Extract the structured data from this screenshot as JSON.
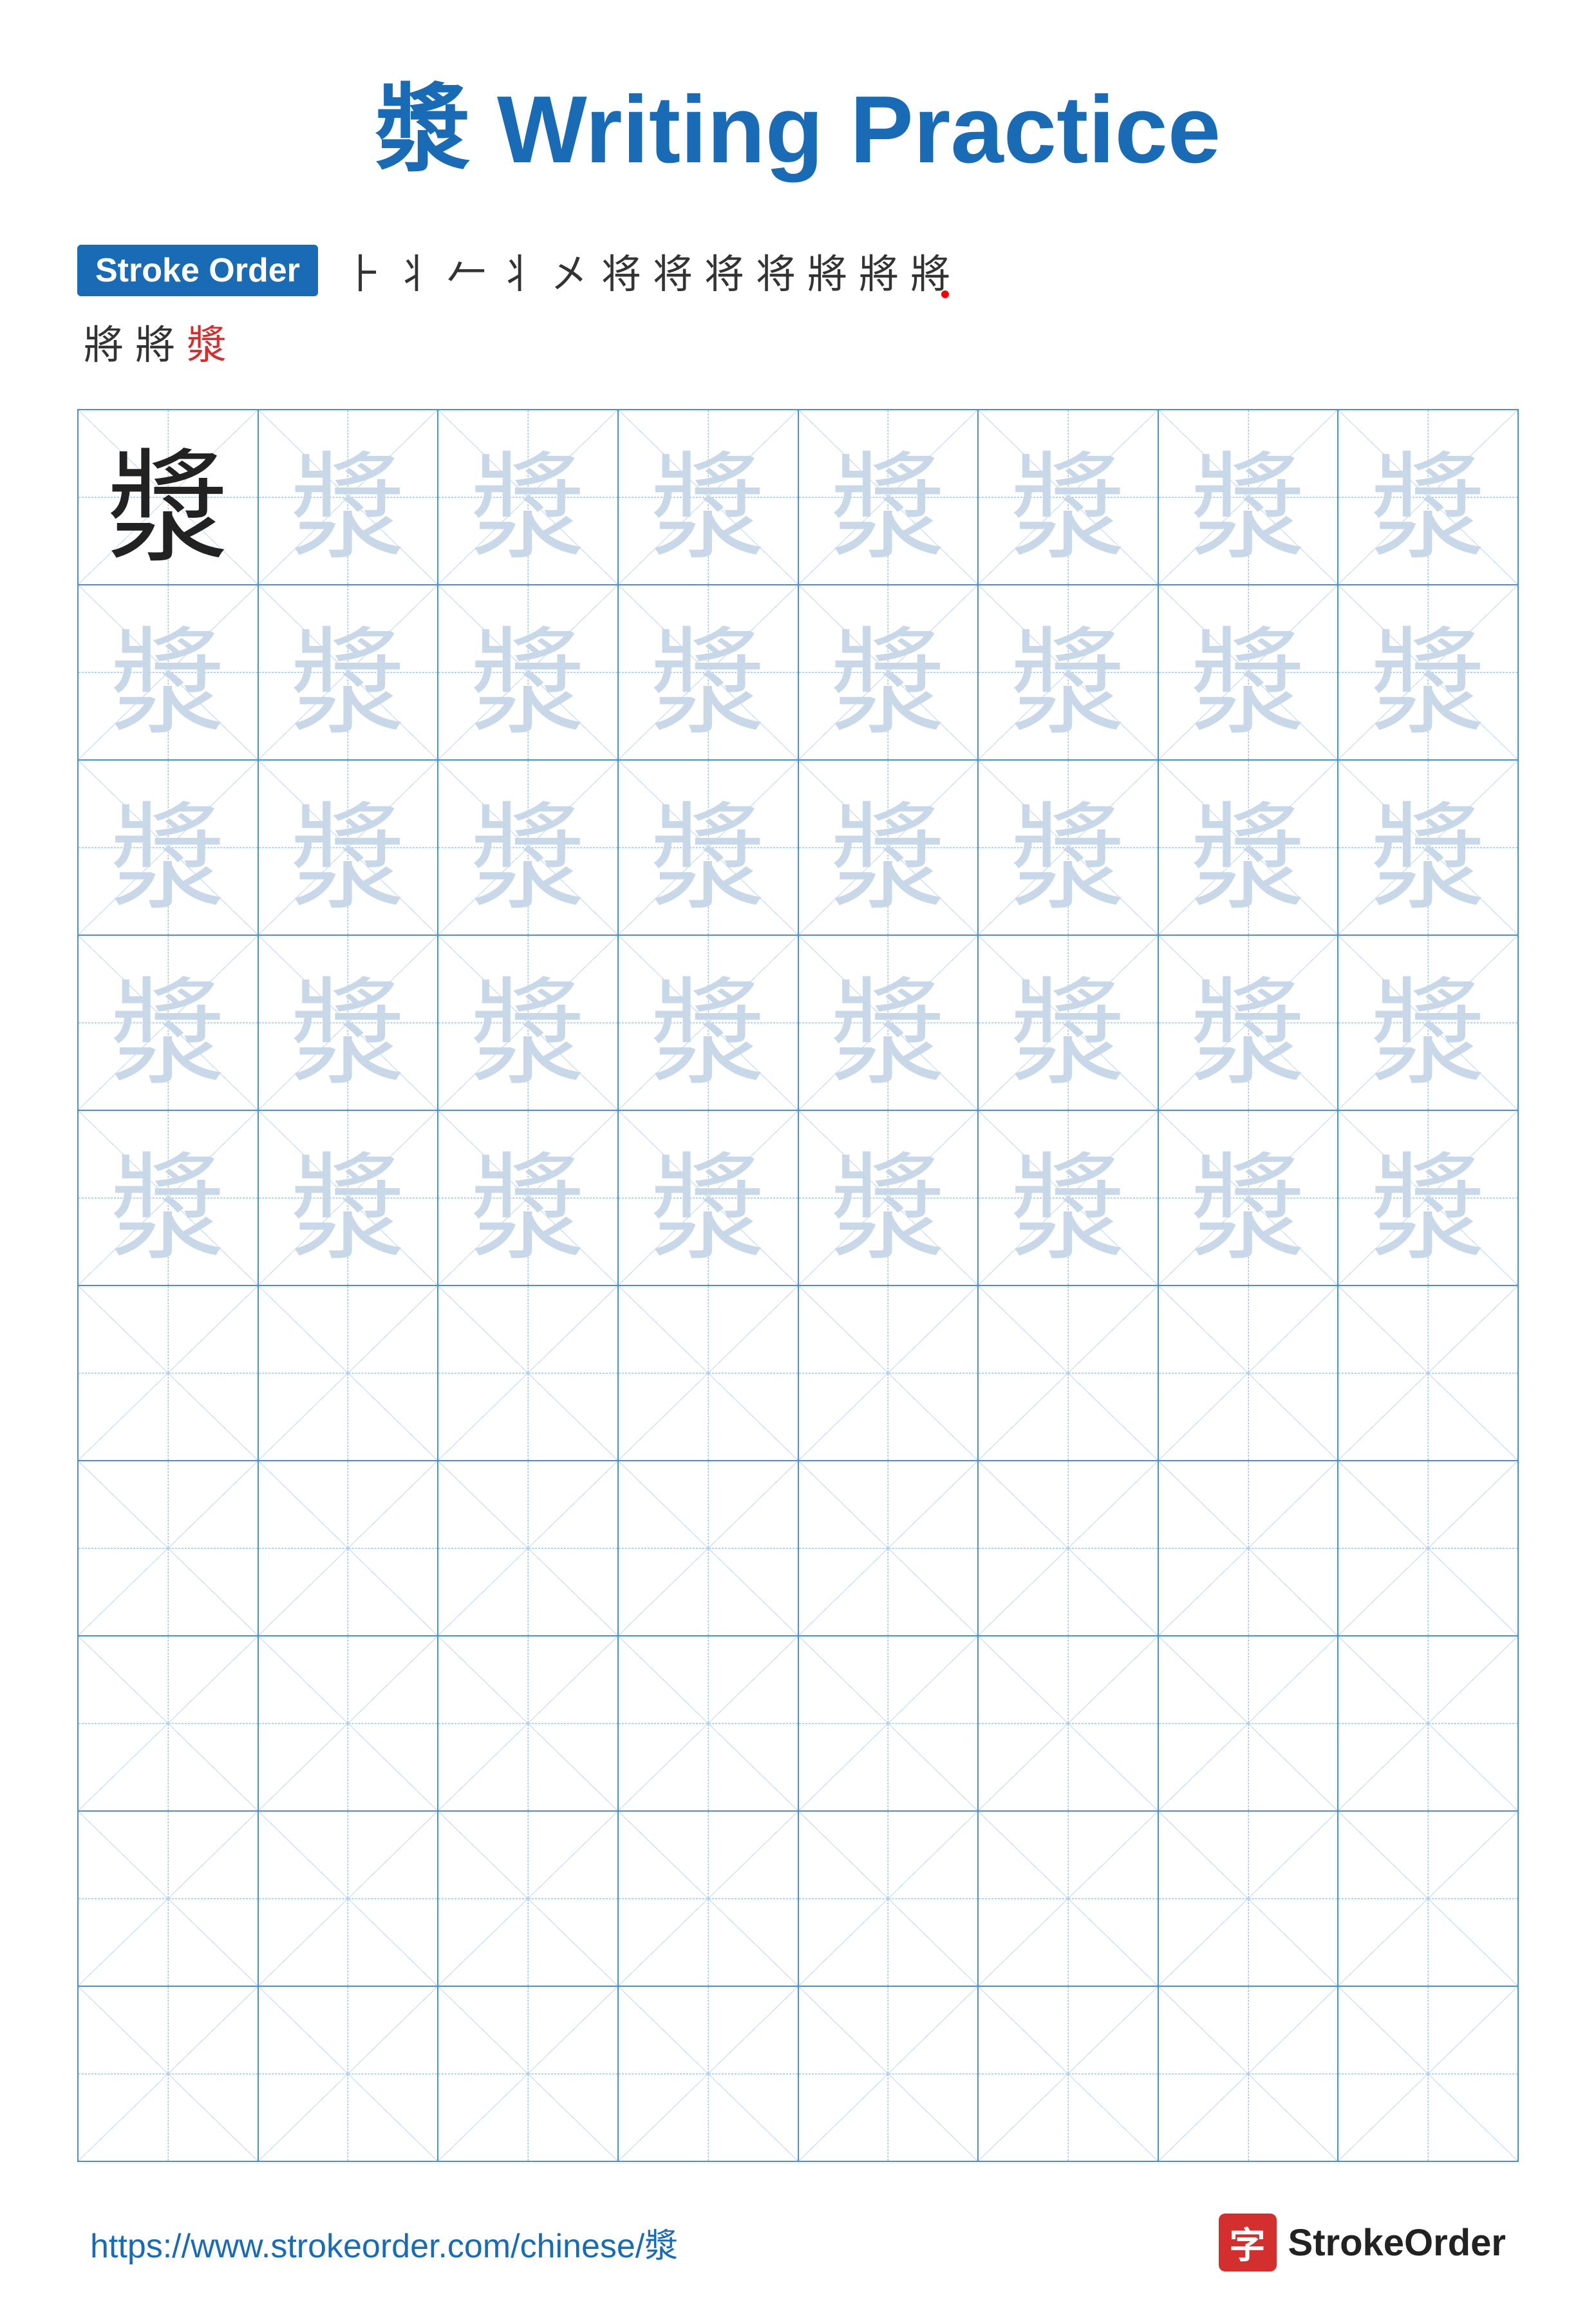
{
  "title": {
    "char": "漿",
    "suffix": " Writing Practice"
  },
  "stroke_order": {
    "badge_label": "Stroke Order",
    "strokes_row1": [
      "⺊",
      "丬",
      "𠂉",
      "丬",
      "㐅",
      "⿺",
      "将",
      "将",
      "将",
      "将",
      "将",
      "将"
    ],
    "strokes_row2": [
      "將",
      "將",
      "漿"
    ]
  },
  "grid": {
    "char": "漿",
    "rows": 10,
    "cols": 8,
    "practice_rows_with_char": 5,
    "empty_rows": 5
  },
  "footer": {
    "url": "https://www.strokeorder.com/chinese/漿",
    "brand_name": "StrokeOrder",
    "brand_char": "字"
  },
  "colors": {
    "blue": "#1a6bb5",
    "light_char": "#c8d8e8",
    "dark_char": "#222222",
    "grid_border": "#4a90d9",
    "guide_line": "#a0c4e8"
  }
}
